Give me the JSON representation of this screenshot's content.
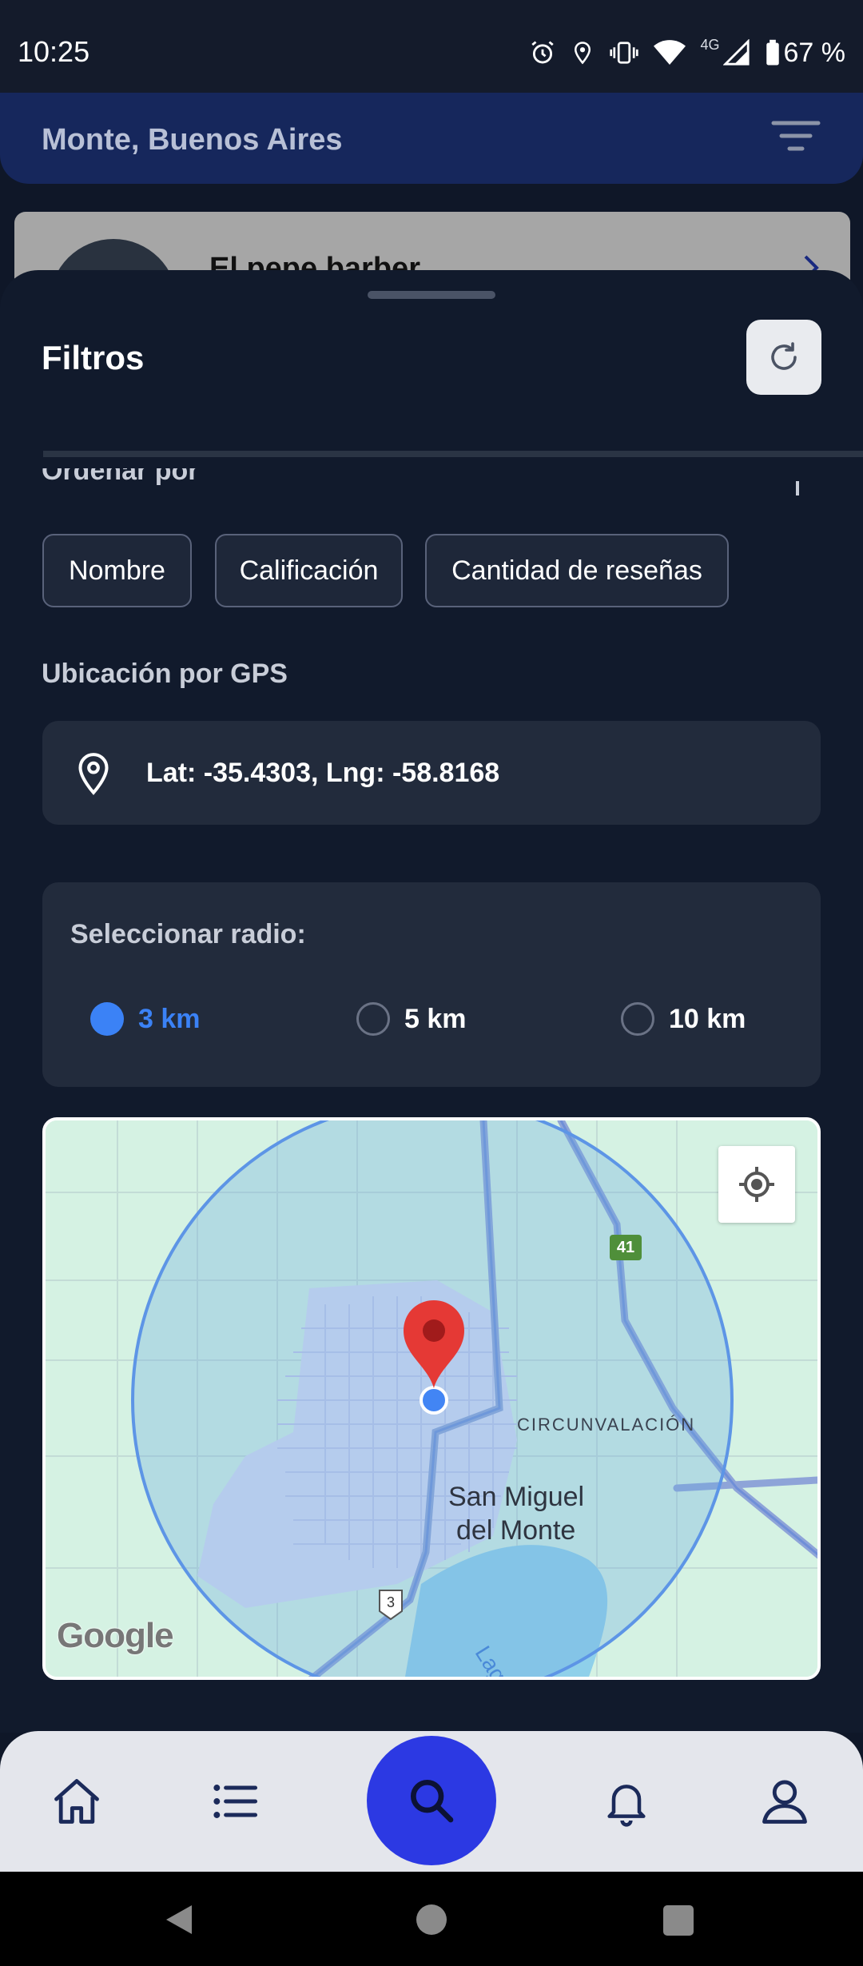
{
  "status_bar": {
    "time": "10:25",
    "network": "4G",
    "battery": "67 %",
    "icons": [
      "alarm-icon",
      "location-icon",
      "vibrate-icon",
      "wifi-icon",
      "signal-icon",
      "battery-icon"
    ]
  },
  "header": {
    "location_title": "Monte, Buenos Aires",
    "filter_icon": "filter-lines-icon"
  },
  "background_list": {
    "card_title": "El pepe barber"
  },
  "sheet": {
    "title": "Filtros",
    "reset_icon": "refresh-icon",
    "sort_label": "Ordenar por",
    "sort_options": [
      "Nombre",
      "Calificación",
      "Cantidad de reseñas"
    ],
    "gps_label": "Ubicación por GPS",
    "gps_value": "Lat: -35.4303, Lng: -58.8168",
    "radius": {
      "title": "Seleccionar radio:",
      "options": [
        "3 km",
        "5 km",
        "10 km"
      ],
      "selected": "3 km"
    },
    "map": {
      "labels": {
        "road": "CIRCUNVALACIÓN",
        "city_line1": "San Miguel",
        "city_line2": "del Monte",
        "route_41": "41",
        "route_3": "3",
        "lake": "Lag",
        "attribution": "Google"
      }
    }
  },
  "bottom_nav": {
    "items": [
      "home-icon",
      "list-icon",
      "search-icon",
      "bell-icon",
      "user-icon"
    ],
    "active": "search-icon"
  },
  "colors": {
    "background": "#0f1728",
    "sheet": "#111a2c",
    "card": "#222b3c",
    "accent_blue": "#3b82f6",
    "search_button": "#2c39e3",
    "header": "#16275c"
  }
}
